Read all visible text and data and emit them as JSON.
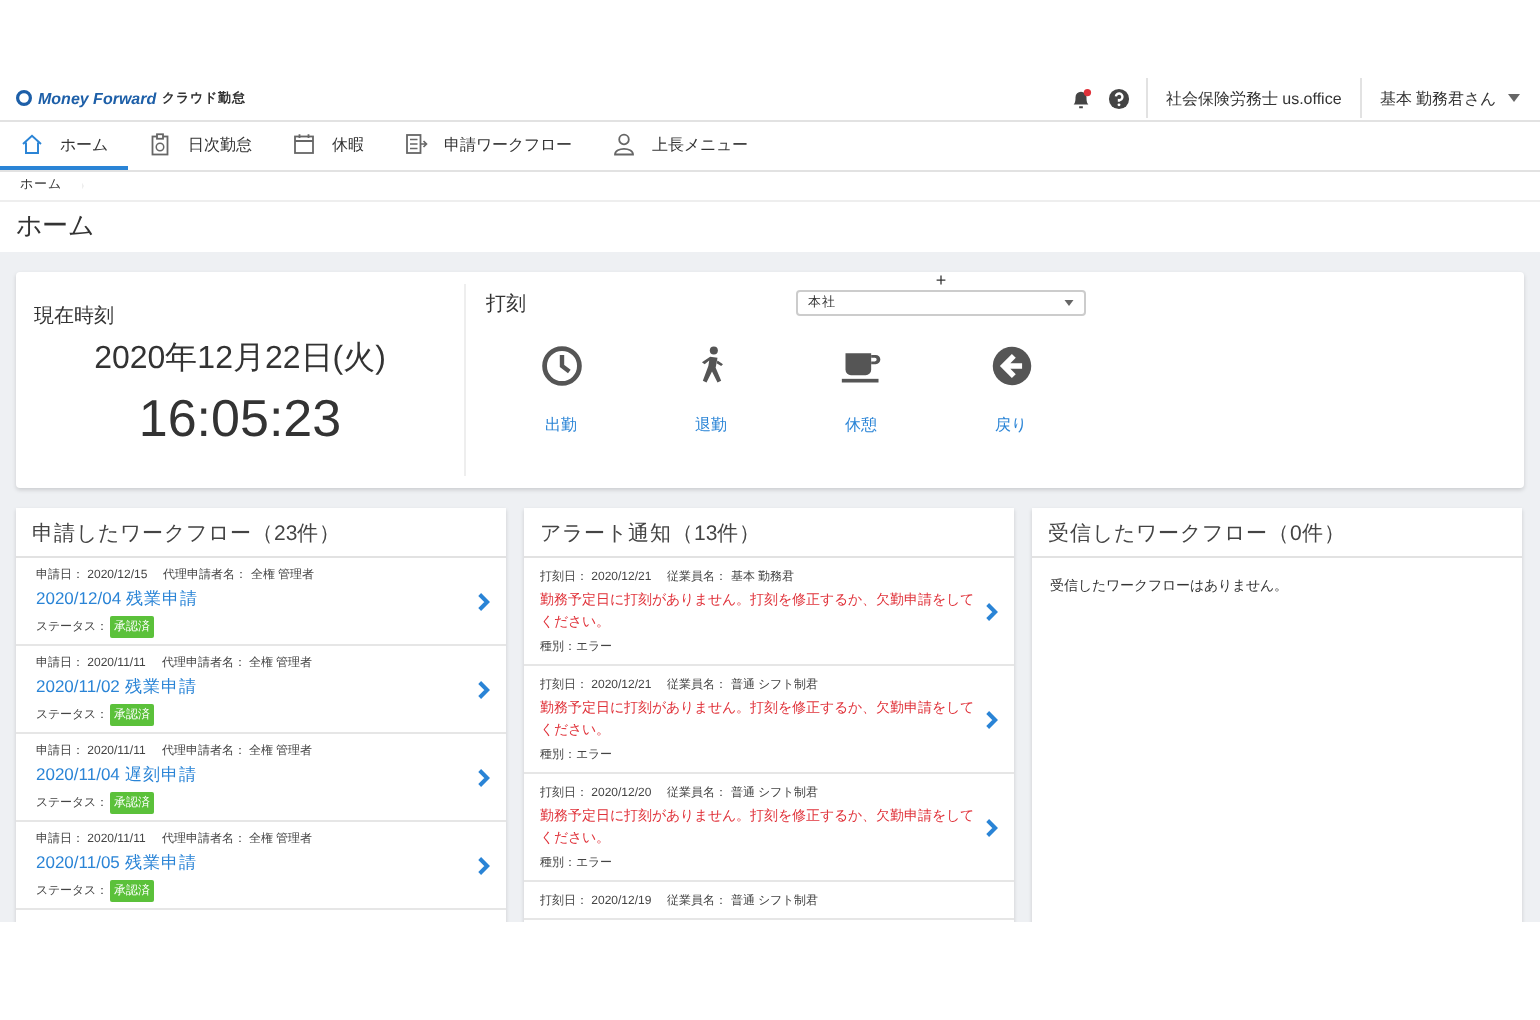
{
  "header": {
    "brand": "Money Forward",
    "product": "クラウド勤怠",
    "office": "社会保険労務士 us.office",
    "user": "基本 勤務君さん"
  },
  "nav": [
    {
      "kind": "home",
      "label": "ホーム",
      "selected": true
    },
    {
      "kind": "daily",
      "label": "日次勤怠",
      "selected": false
    },
    {
      "kind": "calendar",
      "label": "休暇",
      "selected": false
    },
    {
      "kind": "workflow",
      "label": "申請ワークフロー",
      "selected": false
    },
    {
      "kind": "manager",
      "label": "上長メニュー",
      "selected": false
    }
  ],
  "breadcrumb": "ホーム",
  "page_title": "ホーム",
  "clock": {
    "label": "現在時刻",
    "date": "2020年12月22日(火)",
    "time": "16:05:23"
  },
  "stamp": {
    "label": "打刻",
    "add": "+",
    "location": "本社",
    "buttons": [
      {
        "kind": "clock",
        "label": "出勤"
      },
      {
        "kind": "walk",
        "label": "退勤"
      },
      {
        "kind": "cup",
        "label": "休憩"
      },
      {
        "kind": "back",
        "label": "戻り"
      }
    ]
  },
  "sent_workflow": {
    "title": "申請したワークフロー（23件）",
    "items": [
      {
        "date": "申請日： 2020/12/15",
        "proxy": "代理申請者名： 全権 管理者",
        "link": "2020/12/04 残業申請",
        "status_label": "ステータス：",
        "status": "承認済"
      },
      {
        "date": "申請日： 2020/11/11",
        "proxy": "代理申請者名： 全権 管理者",
        "link": "2020/11/02 残業申請",
        "status_label": "ステータス：",
        "status": "承認済"
      },
      {
        "date": "申請日： 2020/11/11",
        "proxy": "代理申請者名： 全権 管理者",
        "link": "2020/11/04 遅刻申請",
        "status_label": "ステータス：",
        "status": "承認済"
      },
      {
        "date": "申請日： 2020/11/11",
        "proxy": "代理申請者名： 全権 管理者",
        "link": "2020/11/05 残業申請",
        "status_label": "ステータス：",
        "status": "承認済"
      }
    ]
  },
  "alerts": {
    "title": "アラート通知（13件）",
    "items": [
      {
        "date": "打刻日： 2020/12/21",
        "employee": "従業員名： 基本 勤務君",
        "message": "勤務予定日に打刻がありません。打刻を修正するか、欠勤申請をしてください。",
        "type": "種別：エラー"
      },
      {
        "date": "打刻日： 2020/12/21",
        "employee": "従業員名： 普通 シフト制君",
        "message": "勤務予定日に打刻がありません。打刻を修正するか、欠勤申請をしてください。",
        "type": "種別：エラー"
      },
      {
        "date": "打刻日： 2020/12/20",
        "employee": "従業員名： 普通 シフト制君",
        "message": "勤務予定日に打刻がありません。打刻を修正するか、欠勤申請をしてください。",
        "type": "種別：エラー"
      },
      {
        "date": "打刻日： 2020/12/19",
        "employee": "従業員名： 普通 シフト制君"
      }
    ]
  },
  "received_workflow": {
    "title": "受信したワークフロー（0件）",
    "empty": "受信したワークフローはありません。"
  }
}
